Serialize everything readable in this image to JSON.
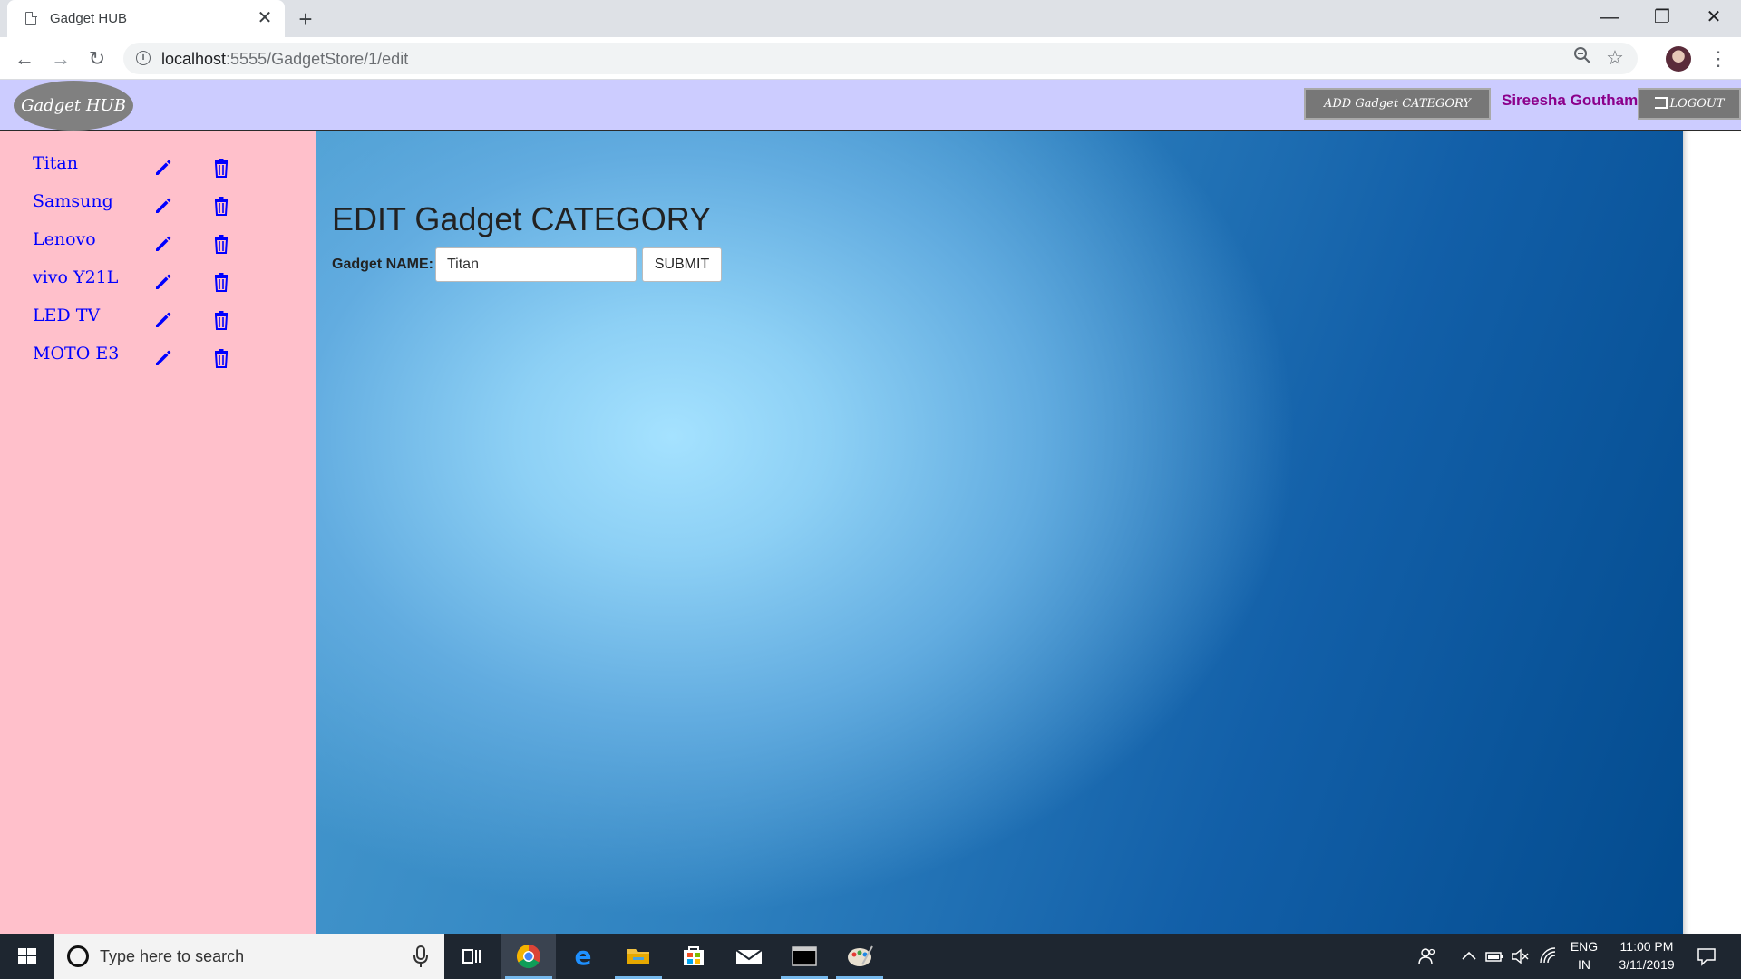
{
  "browser": {
    "tab_title": "Gadget HUB",
    "url_host": "localhost",
    "url_rest": ":5555/GadgetStore/1/edit",
    "icons": [
      "page-icon",
      "close-icon",
      "plus-icon",
      "back-icon",
      "forward-icon",
      "reload-icon",
      "info-icon",
      "zoom-icon",
      "star-icon",
      "menu-icon"
    ]
  },
  "header": {
    "logo": "Gadget HUB",
    "add_category": "ADD Gadget CATEGORY",
    "username": "Sireesha Goutham",
    "logout": "LOGOUT"
  },
  "sidebar": {
    "items": [
      {
        "label": "Titan"
      },
      {
        "label": "Samsung"
      },
      {
        "label": "Lenovo"
      },
      {
        "label": "vivo Y21L"
      },
      {
        "label": "LED TV"
      },
      {
        "label": "MOTO E3"
      }
    ]
  },
  "main": {
    "title": "EDIT Gadget CATEGORY",
    "field_label": "Gadget NAME:",
    "field_value": "Titan",
    "submit": "SUBMIT"
  },
  "taskbar": {
    "search_placeholder": "Type here to search",
    "lang_1": "ENG",
    "lang_2": "IN",
    "time": "11:00 PM",
    "date": "3/11/2019"
  },
  "colors": {
    "sidebar_bg": "#ffc0cb",
    "header_bg": "#ccccff",
    "link_blue": "#0000ff",
    "username": "#8b008b"
  }
}
